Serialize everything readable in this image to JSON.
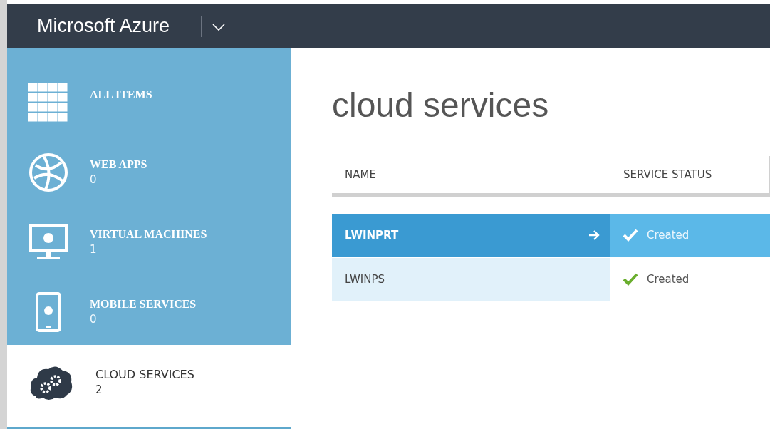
{
  "header": {
    "brand": "Microsoft Azure"
  },
  "sidebar": {
    "items": [
      {
        "kind": "grid",
        "label": "ALL ITEMS",
        "selected": false
      },
      {
        "kind": "globe",
        "label": "WEB APPS",
        "count": "0",
        "selected": false
      },
      {
        "kind": "monitor",
        "label": "VIRTUAL MACHINES",
        "count": "1",
        "selected": false
      },
      {
        "kind": "phone",
        "label": "MOBILE SERVICES",
        "count": "0",
        "selected": false
      },
      {
        "kind": "cloud",
        "label": "CLOUD SERVICES",
        "count": "2",
        "selected": true
      }
    ]
  },
  "page": {
    "title": "cloud services"
  },
  "table": {
    "columns": [
      "NAME",
      "SERVICE STATUS"
    ],
    "rows": [
      {
        "name": "LWINPRT",
        "status": "Created",
        "selected": true
      },
      {
        "name": "LWINPS",
        "status": "Created",
        "selected": false
      }
    ]
  }
}
